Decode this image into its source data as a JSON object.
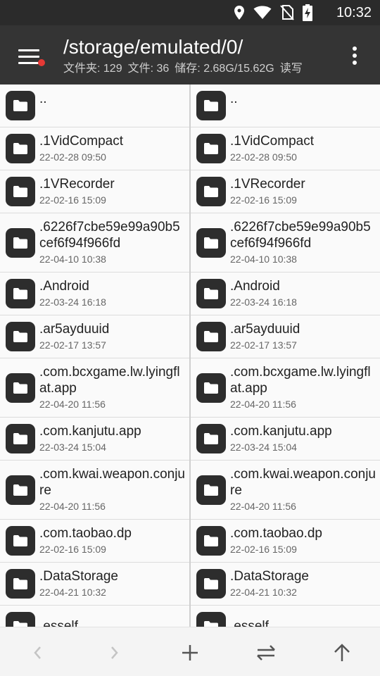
{
  "status_bar": {
    "time": "10:32",
    "icons": [
      "location-icon",
      "wifi-icon",
      "no-sim-icon",
      "battery-charging-icon"
    ]
  },
  "app_bar": {
    "path": "/storage/emulated/0/",
    "folders": "文件夹: 129",
    "files": "文件: 36",
    "storage": "储存: 2.68G/15.62G",
    "access": "读写"
  },
  "left_pane": {
    "up_label": "..",
    "items": [
      {
        "name": ".1VidCompact",
        "date": "22-02-28 09:50"
      },
      {
        "name": ".1VRecorder",
        "date": "22-02-16 15:09"
      },
      {
        "name": ".6226f7cbe59e99a90b5cef6f94f966fd",
        "date": "22-04-10 10:38"
      },
      {
        "name": ".Android",
        "date": "22-03-24 16:18"
      },
      {
        "name": ".ar5ayduuid",
        "date": "22-02-17 13:57"
      },
      {
        "name": ".com.bcxgame.lw.lyingflat.app",
        "date": "22-04-20 11:56"
      },
      {
        "name": ".com.kanjutu.app",
        "date": "22-03-24 15:04"
      },
      {
        "name": ".com.kwai.weapon.conjure",
        "date": "22-04-20 11:56"
      },
      {
        "name": ".com.taobao.dp",
        "date": "22-02-16 15:09"
      },
      {
        "name": ".DataStorage",
        "date": "22-04-21 10:32"
      },
      {
        "name": ".esself",
        "date": ""
      }
    ]
  },
  "right_pane": {
    "up_label": "..",
    "items": [
      {
        "name": ".1VidCompact",
        "date": "22-02-28 09:50"
      },
      {
        "name": ".1VRecorder",
        "date": "22-02-16 15:09"
      },
      {
        "name": ".6226f7cbe59e99a90b5cef6f94f966fd",
        "date": "22-04-10 10:38"
      },
      {
        "name": ".Android",
        "date": "22-03-24 16:18"
      },
      {
        "name": ".ar5ayduuid",
        "date": "22-02-17 13:57"
      },
      {
        "name": ".com.bcxgame.lw.lyingflat.app",
        "date": "22-04-20 11:56"
      },
      {
        "name": ".com.kanjutu.app",
        "date": "22-03-24 15:04"
      },
      {
        "name": ".com.kwai.weapon.conjure",
        "date": "22-04-20 11:56"
      },
      {
        "name": ".com.taobao.dp",
        "date": "22-02-16 15:09"
      },
      {
        "name": ".DataStorage",
        "date": "22-04-21 10:32"
      },
      {
        "name": ".esself",
        "date": ""
      }
    ]
  },
  "bottom_bar": {
    "buttons": [
      "back-icon",
      "forward-icon",
      "add-icon",
      "swap-icon",
      "up-icon"
    ]
  },
  "colors": {
    "status_bar": "#2b2b2b",
    "app_bar": "#343434",
    "folder_icon_bg": "#2d2d2d",
    "menu_badge": "#e53935"
  }
}
